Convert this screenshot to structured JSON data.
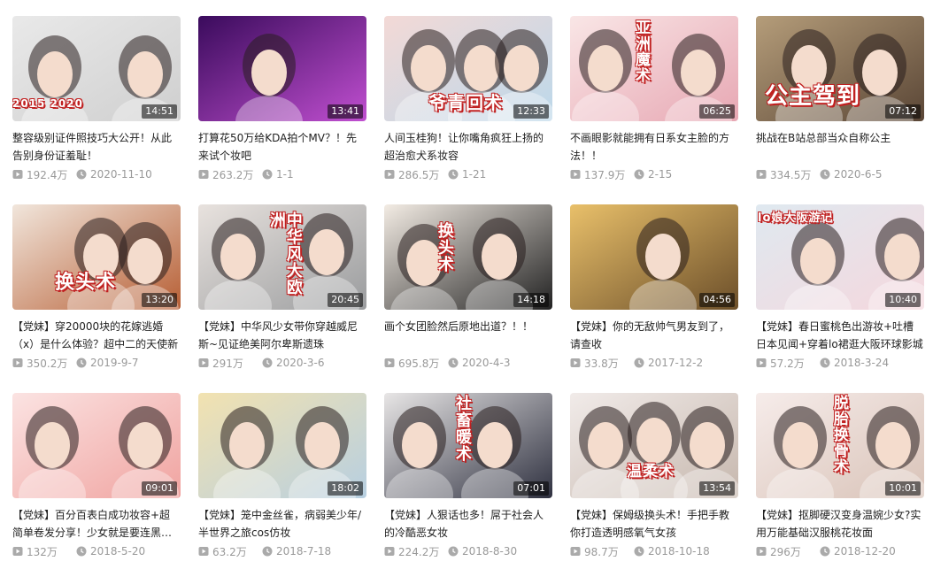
{
  "colors": {
    "title": "#212121",
    "meta": "#999999",
    "duration_bg": "rgba(0,0,0,0.55)",
    "overlay_red": "#c02020"
  },
  "icons": {
    "views": "play-count-icon",
    "date": "clock-icon"
  },
  "videos": [
    {
      "title": "整容级别证件照技巧大公开！从此告别身份证羞耻！",
      "views": "192.4万",
      "date": "2020-11-10",
      "duration": "14:51",
      "overlay": "2015  2020",
      "bg1": "#e9e9e9",
      "bg2": "#cfcfcf"
    },
    {
      "title": "打算花50万给KDA拍个MV？！先来试个妆吧",
      "views": "263.2万",
      "date": "1-1",
      "duration": "13:41",
      "overlay": "",
      "bg1": "#3a0b5c",
      "bg2": "#c04fd0"
    },
    {
      "title": "人间玉桂狗！让你嘴角疯狂上扬的超治愈犬系妆容",
      "views": "286.5万",
      "date": "1-21",
      "duration": "12:33",
      "overlay": "爷青回术",
      "bg1": "#f3d9d6",
      "bg2": "#bcd8ea"
    },
    {
      "title": "不画眼影就能拥有日系女主脸的方法！！",
      "views": "137.9万",
      "date": "2-15",
      "duration": "06:25",
      "overlay": "亚洲魔术",
      "bg1": "#f9e6e6",
      "bg2": "#e7a7b3"
    },
    {
      "title": "挑战在B站总部当众自称公主",
      "views": "334.5万",
      "date": "2020-6-5",
      "duration": "07:12",
      "overlay": "公主驾到",
      "bg1": "#b59d7a",
      "bg2": "#5a4636"
    },
    {
      "title": "【党妹】穿20000块的花嫁逃婚（x）是什么体验？超中二的天使新",
      "views": "350.2万",
      "date": "2019-9-7",
      "duration": "13:20",
      "overlay": "换头术",
      "bg1": "#f1e6dc",
      "bg2": "#b75f35"
    },
    {
      "title": "【党妹】中华风少女带你穿越威尼斯~见证绝美阿尔卑斯遗珠",
      "views": "291万",
      "date": "2020-3-6",
      "duration": "20:45",
      "overlay": "中华风大欧洲",
      "bg1": "#e8e2de",
      "bg2": "#9a9c9e"
    },
    {
      "title": "画个女团脸然后原地出道？！！",
      "views": "695.8万",
      "date": "2020-4-3",
      "duration": "14:18",
      "overlay": "换头术",
      "bg1": "#f3ece4",
      "bg2": "#222222"
    },
    {
      "title": "【党妹】你的无敌帅气男友到了，请查收",
      "views": "33.8万",
      "date": "2017-12-2",
      "duration": "04:56",
      "overlay": "",
      "bg1": "#e9c06a",
      "bg2": "#6c4f2a"
    },
    {
      "title": "【党妹】春日蜜桃色出游妆+吐槽日本见闻+穿着lo裙逛大阪环球影城",
      "views": "57.2万",
      "date": "2018-3-24",
      "duration": "10:40",
      "overlay": "lo娘大阪游记",
      "bg1": "#dfe9f0",
      "bg2": "#f5d7dd"
    },
    {
      "title": "【党妹】百分百表白成功妆容+超简单卷发分享！少女就是要连黑眼圈",
      "views": "132万",
      "date": "2018-5-20",
      "duration": "09:01",
      "overlay": "",
      "bg1": "#fbe3e2",
      "bg2": "#f0a3a0"
    },
    {
      "title": "【党妹】笼中金丝雀，病弱美少年/半世界之旅cos仿妆",
      "views": "63.2万",
      "date": "2018-7-18",
      "duration": "18:02",
      "overlay": "",
      "bg1": "#f2e2b0",
      "bg2": "#b7cfe1"
    },
    {
      "title": "【党妹】人狠话也多！屌于社会人的冷酷恶女妆",
      "views": "224.2万",
      "date": "2018-8-30",
      "duration": "07:01",
      "overlay": "社畜暖术",
      "bg1": "#e8e6e6",
      "bg2": "#2f3140"
    },
    {
      "title": "【党妹】保姆级换头术！手把手教你打造透明感氧气女孩",
      "views": "98.7万",
      "date": "2018-10-18",
      "duration": "13:54",
      "overlay": "温柔术",
      "bg1": "#f1ebe9",
      "bg2": "#c6b7ad"
    },
    {
      "title": "【党妹】抠脚硬汉变身温婉少女?实用万能基础汉服桃花妆面",
      "views": "296万",
      "date": "2018-12-20",
      "duration": "10:01",
      "overlay": "脱胎换骨术",
      "bg1": "#f6ecea",
      "bg2": "#d9c3b8"
    }
  ]
}
